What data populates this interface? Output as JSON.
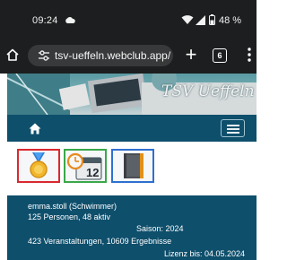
{
  "status_bar": {
    "time": "09:24",
    "battery": "48 %",
    "icons": [
      "cloud-icon",
      "wifi-icon",
      "signal-icon",
      "battery-icon"
    ]
  },
  "browser": {
    "url": "tsv-ueffeln.webclub.app/",
    "tab_count": "6",
    "new_tab_label": "+"
  },
  "site": {
    "title": "TSV Ueffeln"
  },
  "modules": [
    {
      "name": "awards",
      "icon": "medal-icon",
      "calendar_day": ""
    },
    {
      "name": "calendar",
      "icon": "calendar-icon",
      "calendar_day": "12"
    },
    {
      "name": "book",
      "icon": "book-icon",
      "calendar_day": ""
    }
  ],
  "info": {
    "user": "emma.stoll (Schwimmer)",
    "persons": "125 Personen, 48 aktiv",
    "season": "Saison: 2024",
    "events": "423 Veranstaltungen, 10609 Ergebnisse",
    "license": "Lizenz bis: 04.05.2024"
  },
  "colors": {
    "nav_bg": "#0e4f6c",
    "browser_bg": "#1c1e1f",
    "module_border_awards": "#d9282f",
    "module_border_calendar": "#3aa84a",
    "module_border_book": "#2f6fd1"
  }
}
